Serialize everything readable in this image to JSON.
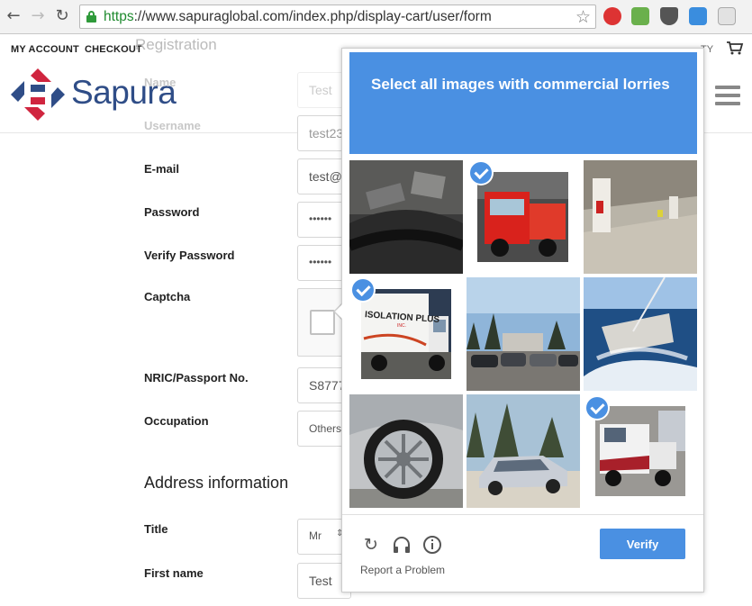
{
  "browser": {
    "url_scheme": "https",
    "url_rest": "://www.sapuraglobal.com/index.php/display-cart/user/form"
  },
  "header": {
    "nav": [
      "MY ACCOUNT",
      "CHECKOUT"
    ],
    "right_fragment": "TY",
    "brand": "Sapura"
  },
  "form": {
    "title": "Registration",
    "name_label": "Name",
    "name_value": "Test",
    "username_label": "Username",
    "username_value": "test23",
    "email_label": "E-mail",
    "email_value": "test@",
    "password_label": "Password",
    "password_value": "••••••",
    "verify_password_label": "Verify Password",
    "verify_password_value": "••••••",
    "captcha_label": "Captcha",
    "nric_label": "NRIC/Passport No.",
    "nric_value": "S8777",
    "occupation_label": "Occupation",
    "occupation_value": "Others",
    "address_section": "Address information",
    "title_label": "Title",
    "title_value": "Mr",
    "first_name_label": "First name",
    "first_name_value": "Test"
  },
  "captcha": {
    "instruction": "Select all images with commercial lorries",
    "tiles": [
      {
        "subject": "tire-underside",
        "selected": false
      },
      {
        "subject": "red-truck",
        "selected": true
      },
      {
        "subject": "parking-garage",
        "selected": false
      },
      {
        "subject": "isolation-plus-truck",
        "selected": true
      },
      {
        "subject": "parking-lot-cars",
        "selected": false
      },
      {
        "subject": "sailboat",
        "selected": false
      },
      {
        "subject": "car-wheel",
        "selected": false
      },
      {
        "subject": "silver-sedan",
        "selected": false
      },
      {
        "subject": "semi-truck-cab",
        "selected": true
      }
    ],
    "truck_sign_text": "ISOLATION PLUS",
    "truck_sign_subtext": "INC.",
    "report_label": "Report a Problem",
    "verify_label": "Verify"
  },
  "colors": {
    "accent": "#4a90e2",
    "brand": "#2f4d87",
    "brand_red": "#d0253f"
  }
}
